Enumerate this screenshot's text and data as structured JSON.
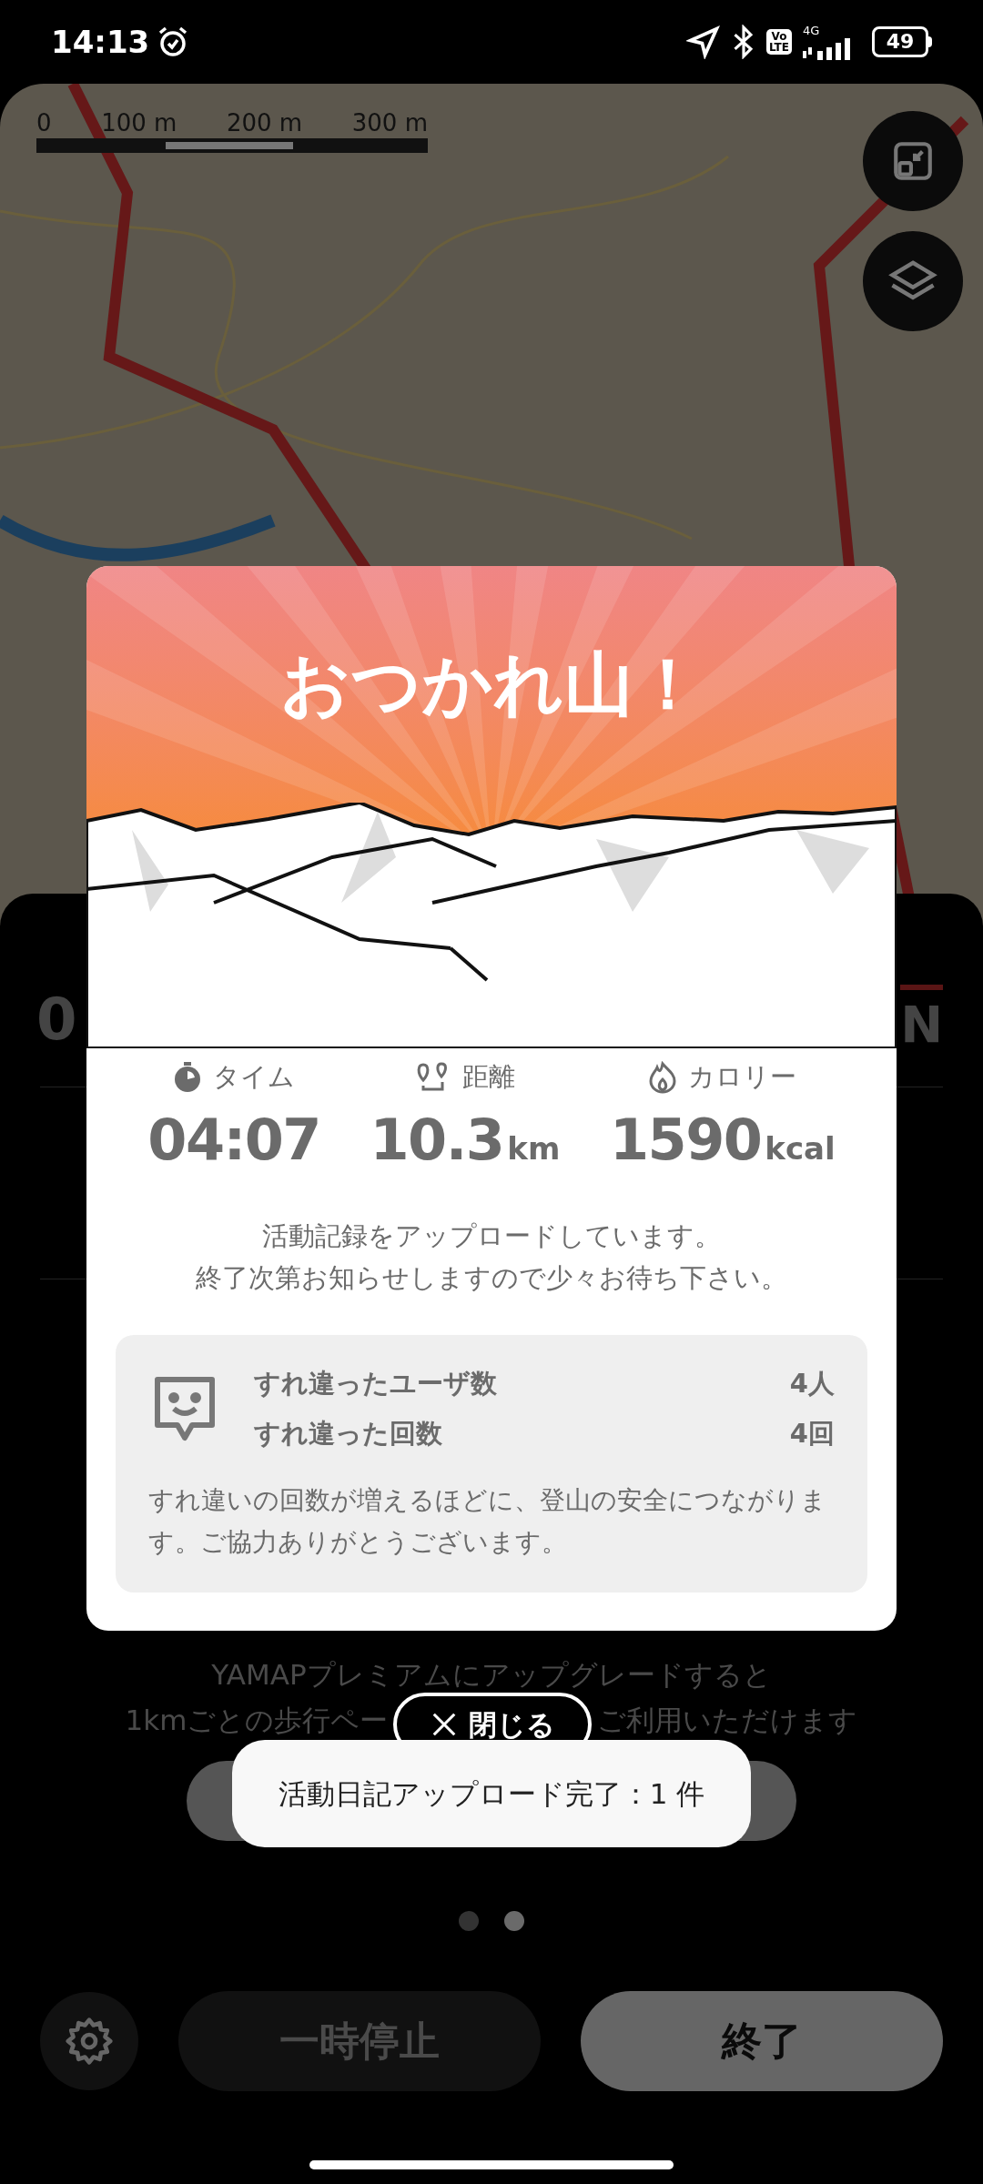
{
  "status_bar": {
    "time": "14:13",
    "volte": [
      "Vo",
      "LTE"
    ],
    "network": "4G",
    "battery": "49"
  },
  "map": {
    "scale_labels": [
      "0",
      "100 m",
      "200 m",
      "300 m"
    ]
  },
  "background": {
    "elapsed_partial": "0",
    "compass": "N",
    "premium_line1": "YAMAPプレミアムにアップグレードすると",
    "premium_line2_parts": [
      "1kmごとの歩行ペー",
      "ご利用いただけます"
    ],
    "pager": [
      {
        "selected": false
      },
      {
        "selected": true
      }
    ]
  },
  "dialog": {
    "title": "おつかれ山！",
    "stats": [
      {
        "kind": "time",
        "label": "タイム",
        "value": "04:07"
      },
      {
        "kind": "distance",
        "label": "距離",
        "value": "10.3",
        "unit": "km"
      },
      {
        "kind": "calorie",
        "label": "カロリー",
        "value": "1590",
        "unit": "kcal"
      }
    ],
    "message_lines": [
      "活動記録をアップロードしています。",
      "終了次第お知らせしますので少々お待ち下さい。"
    ],
    "encounter": {
      "rows": [
        {
          "label": "すれ違ったユーザ数",
          "value": "4人"
        },
        {
          "label": "すれ違った回数",
          "value": "4回"
        }
      ],
      "note": "すれ違いの回数が増えるほどに、登山の安全につながります。ご協力ありがとうございます。"
    },
    "close_button": "閉じる"
  },
  "toast": "活動日記アップロード完了：1 件",
  "controls": {
    "pause": "一時停止",
    "finish": "終了"
  }
}
